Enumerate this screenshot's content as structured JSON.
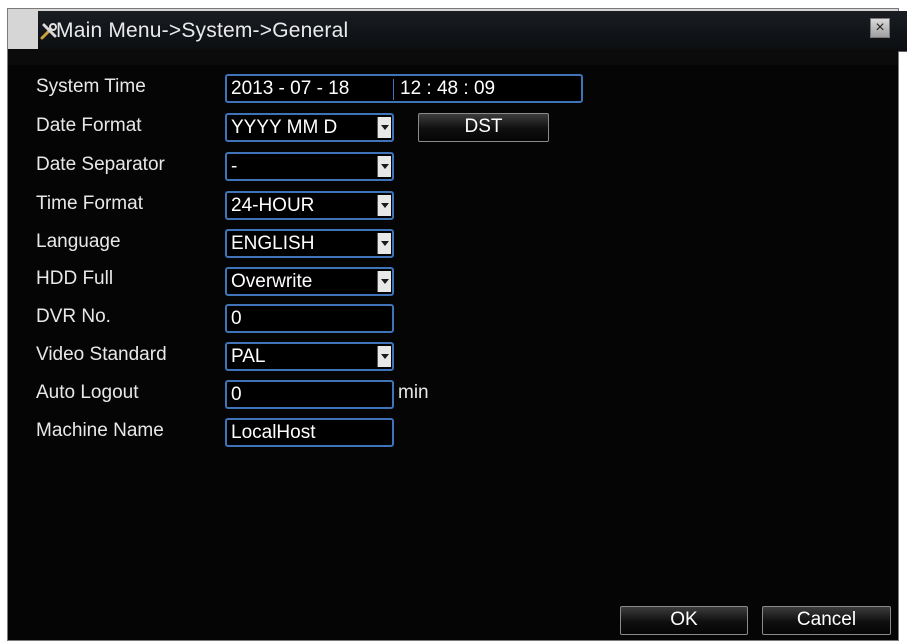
{
  "window": {
    "title": "Main Menu->System->General",
    "title_icon": "tools-icon",
    "close_label": "×"
  },
  "form": {
    "system_time": {
      "label": "System Time",
      "date": "2013 - 07 - 18",
      "time": "12 : 48 : 09"
    },
    "date_format": {
      "label": "Date Format",
      "value": "YYYY MM D",
      "dst_label": "DST"
    },
    "date_separator": {
      "label": "Date Separator",
      "value": "-"
    },
    "time_format": {
      "label": "Time Format",
      "value": "24-HOUR"
    },
    "language": {
      "label": "Language",
      "value": "ENGLISH"
    },
    "hdd_full": {
      "label": "HDD Full",
      "value": "Overwrite"
    },
    "dvr_no": {
      "label": "DVR No.",
      "value": "0"
    },
    "video_standard": {
      "label": "Video Standard",
      "value": "PAL"
    },
    "auto_logout": {
      "label": "Auto Logout",
      "value": "0",
      "unit": "min"
    },
    "machine_name": {
      "label": "Machine Name",
      "value": "LocalHost"
    }
  },
  "footer": {
    "ok_label": "OK",
    "cancel_label": "Cancel"
  },
  "colors": {
    "field_border": "#3f74b8",
    "background": "#050505",
    "text": "#e8e8e8"
  }
}
